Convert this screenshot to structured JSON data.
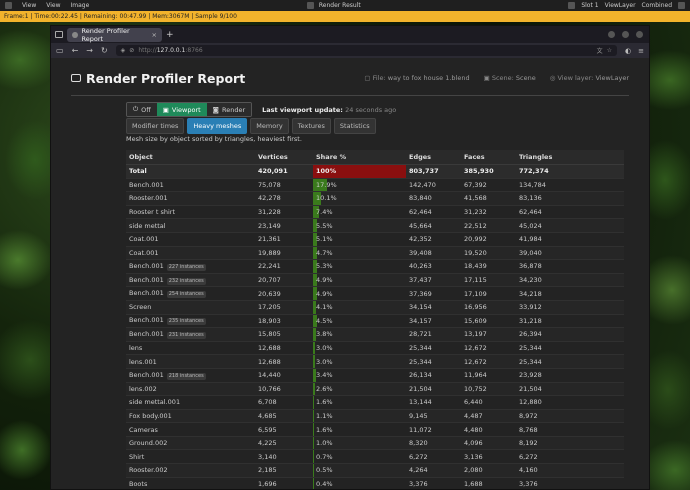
{
  "blender": {
    "menus": [
      "View",
      "View",
      "Image"
    ],
    "render_title": "Render Result",
    "slot": "Slot 1",
    "view_layer": "ViewLayer",
    "combined": "Combined",
    "status": "Frame:1 | Time:00:22.45 | Remaining: 00:47.99 | Mem:3067M | Sample 9/100"
  },
  "browser": {
    "tab_title": "Render Profiler Report",
    "tab_close": "×",
    "new_tab": "+",
    "url_scheme": "http://",
    "url_host": "127.0.0.1",
    "url_port": ":8766"
  },
  "report": {
    "title": "Render Profiler Report",
    "file_label": "File:",
    "file": "way to fox house 1.blend",
    "scene_label": "Scene:",
    "scene": "Scene",
    "viewlayer_label": "View layer:",
    "viewlayer": "ViewLayer",
    "modes": [
      "Off",
      "Viewport",
      "Render"
    ],
    "active_mode": 1,
    "update_label": "Last viewport update:",
    "update_value": "24 seconds ago",
    "tabs": [
      "Modifier times",
      "Heavy meshes",
      "Memory",
      "Textures",
      "Statistics"
    ],
    "active_tab": 1,
    "description": "Mesh size by object sorted by triangles, heaviest first.",
    "columns": [
      "Object",
      "Vertices",
      "Share %",
      "Edges",
      "Faces",
      "Triangles"
    ],
    "total": {
      "name": "Total",
      "vertices": "420,091",
      "share": "100%",
      "edges": "803,737",
      "faces": "385,930",
      "triangles": "772,374"
    },
    "rows": [
      {
        "name": "Bench.001",
        "inst": "",
        "vertices": "75,078",
        "share": "17.9%",
        "share_value": 17.9,
        "edges": "142,470",
        "faces": "67,392",
        "triangles": "134,784"
      },
      {
        "name": "Rooster.001",
        "inst": "",
        "vertices": "42,278",
        "share": "10.1%",
        "share_value": 10.1,
        "edges": "83,840",
        "faces": "41,568",
        "triangles": "83,136"
      },
      {
        "name": "Rooster t shirt",
        "inst": "",
        "vertices": "31,228",
        "share": "7.4%",
        "share_value": 7.4,
        "edges": "62,464",
        "faces": "31,232",
        "triangles": "62,464"
      },
      {
        "name": "side mettal",
        "inst": "",
        "vertices": "23,149",
        "share": "5.5%",
        "share_value": 5.5,
        "edges": "45,664",
        "faces": "22,512",
        "triangles": "45,024"
      },
      {
        "name": "Coat.001",
        "inst": "",
        "vertices": "21,361",
        "share": "5.1%",
        "share_value": 5.1,
        "edges": "42,352",
        "faces": "20,992",
        "triangles": "41,984"
      },
      {
        "name": "Coat.001",
        "inst": "",
        "vertices": "19,889",
        "share": "4.7%",
        "share_value": 4.7,
        "edges": "39,408",
        "faces": "19,520",
        "triangles": "39,040"
      },
      {
        "name": "Bench.001",
        "inst": "227 instances",
        "vertices": "22,241",
        "share": "5.3%",
        "share_value": 5.3,
        "edges": "40,263",
        "faces": "18,439",
        "triangles": "36,878"
      },
      {
        "name": "Bench.001",
        "inst": "232 instances",
        "vertices": "20,707",
        "share": "4.9%",
        "share_value": 4.9,
        "edges": "37,437",
        "faces": "17,115",
        "triangles": "34,230"
      },
      {
        "name": "Bench.001",
        "inst": "254 instances",
        "vertices": "20,639",
        "share": "4.9%",
        "share_value": 4.9,
        "edges": "37,369",
        "faces": "17,109",
        "triangles": "34,218"
      },
      {
        "name": "Screen",
        "inst": "",
        "vertices": "17,205",
        "share": "4.1%",
        "share_value": 4.1,
        "edges": "34,154",
        "faces": "16,956",
        "triangles": "33,912"
      },
      {
        "name": "Bench.001",
        "inst": "235 instances",
        "vertices": "18,903",
        "share": "4.5%",
        "share_value": 4.5,
        "edges": "34,157",
        "faces": "15,609",
        "triangles": "31,218"
      },
      {
        "name": "Bench.001",
        "inst": "231 instances",
        "vertices": "15,805",
        "share": "3.8%",
        "share_value": 3.8,
        "edges": "28,721",
        "faces": "13,197",
        "triangles": "26,394"
      },
      {
        "name": "lens",
        "inst": "",
        "vertices": "12,688",
        "share": "3.0%",
        "share_value": 3.0,
        "edges": "25,344",
        "faces": "12,672",
        "triangles": "25,344"
      },
      {
        "name": "lens.001",
        "inst": "",
        "vertices": "12,688",
        "share": "3.0%",
        "share_value": 3.0,
        "edges": "25,344",
        "faces": "12,672",
        "triangles": "25,344"
      },
      {
        "name": "Bench.001",
        "inst": "218 instances",
        "vertices": "14,440",
        "share": "3.4%",
        "share_value": 3.4,
        "edges": "26,134",
        "faces": "11,964",
        "triangles": "23,928"
      },
      {
        "name": "lens.002",
        "inst": "",
        "vertices": "10,766",
        "share": "2.6%",
        "share_value": 2.6,
        "edges": "21,504",
        "faces": "10,752",
        "triangles": "21,504"
      },
      {
        "name": "side mettal.001",
        "inst": "",
        "vertices": "6,708",
        "share": "1.6%",
        "share_value": 1.6,
        "edges": "13,144",
        "faces": "6,440",
        "triangles": "12,880"
      },
      {
        "name": "Fox body.001",
        "inst": "",
        "vertices": "4,685",
        "share": "1.1%",
        "share_value": 1.1,
        "edges": "9,145",
        "faces": "4,487",
        "triangles": "8,972"
      },
      {
        "name": "Cameras",
        "inst": "",
        "vertices": "6,595",
        "share": "1.6%",
        "share_value": 1.6,
        "edges": "11,072",
        "faces": "4,480",
        "triangles": "8,768"
      },
      {
        "name": "Ground.002",
        "inst": "",
        "vertices": "4,225",
        "share": "1.0%",
        "share_value": 1.0,
        "edges": "8,320",
        "faces": "4,096",
        "triangles": "8,192"
      },
      {
        "name": "Shirt",
        "inst": "",
        "vertices": "3,140",
        "share": "0.7%",
        "share_value": 0.7,
        "edges": "6,272",
        "faces": "3,136",
        "triangles": "6,272"
      },
      {
        "name": "Rooster.002",
        "inst": "",
        "vertices": "2,185",
        "share": "0.5%",
        "share_value": 0.5,
        "edges": "4,264",
        "faces": "2,080",
        "triangles": "4,160"
      },
      {
        "name": "Boots",
        "inst": "",
        "vertices": "1,696",
        "share": "0.4%",
        "share_value": 0.4,
        "edges": "3,376",
        "faces": "1,688",
        "triangles": "3,376"
      }
    ]
  },
  "colors": {
    "accent_green": "#1f8a5a",
    "tab_blue": "#2a7fb5",
    "bar_green": "#3a7a1c",
    "total_red": "#8a0f0f",
    "status_orange": "#f2b32c"
  }
}
